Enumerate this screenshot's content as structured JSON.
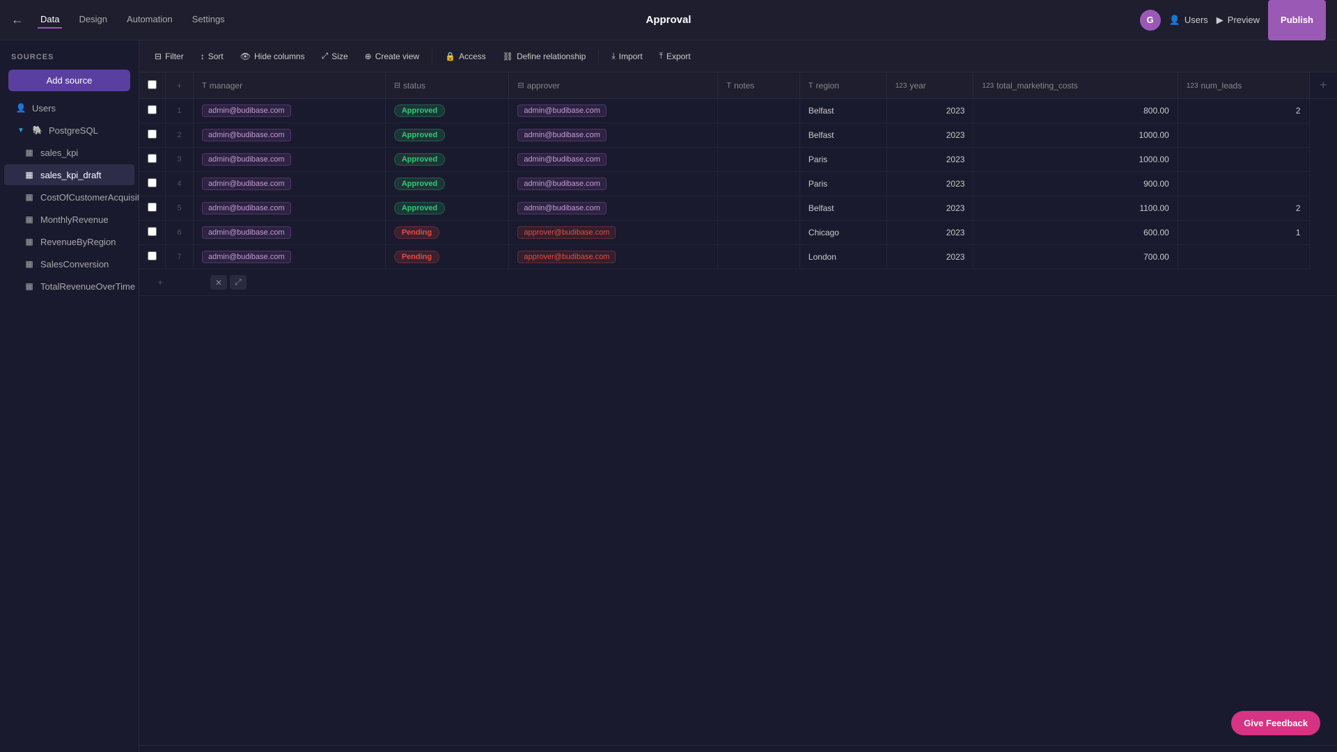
{
  "topnav": {
    "app_title": "Approval",
    "tabs": [
      {
        "label": "Data",
        "active": true
      },
      {
        "label": "Design",
        "active": false
      },
      {
        "label": "Automation",
        "active": false
      },
      {
        "label": "Settings",
        "active": false
      }
    ],
    "avatar_letter": "G",
    "users_label": "Users",
    "preview_label": "Preview",
    "publish_label": "Publish"
  },
  "sidebar": {
    "header": "Sources",
    "add_source_label": "Add source",
    "items": [
      {
        "label": "Users",
        "type": "users",
        "indent": 0
      },
      {
        "label": "PostgreSQL",
        "type": "postgres",
        "indent": 0,
        "expanded": true
      },
      {
        "label": "sales_kpi",
        "type": "table",
        "indent": 1
      },
      {
        "label": "sales_kpi_draft",
        "type": "table",
        "indent": 1,
        "active": true
      },
      {
        "label": "CostOfCustomerAcquisition",
        "type": "table",
        "indent": 1
      },
      {
        "label": "MonthlyRevenue",
        "type": "table",
        "indent": 1
      },
      {
        "label": "RevenueByRegion",
        "type": "table",
        "indent": 1
      },
      {
        "label": "SalesConversion",
        "type": "table",
        "indent": 1
      },
      {
        "label": "TotalRevenueOverTime",
        "type": "table",
        "indent": 1
      }
    ]
  },
  "toolbar": {
    "filter_label": "Filter",
    "sort_label": "Sort",
    "hide_columns_label": "Hide columns",
    "size_label": "Size",
    "create_view_label": "Create view",
    "access_label": "Access",
    "define_relationship_label": "Define relationship",
    "import_label": "Import",
    "export_label": "Export"
  },
  "table": {
    "columns": [
      {
        "name": "manager",
        "type": "text"
      },
      {
        "name": "status",
        "type": "text"
      },
      {
        "name": "approver",
        "type": "text"
      },
      {
        "name": "notes",
        "type": "text"
      },
      {
        "name": "region",
        "type": "text"
      },
      {
        "name": "year",
        "type": "number"
      },
      {
        "name": "total_marketing_costs",
        "type": "number"
      },
      {
        "name": "num_leads",
        "type": "number"
      }
    ],
    "rows": [
      {
        "id": 1,
        "manager": "admin@budibase.com",
        "status": "Approved",
        "approver": "admin@budibase.com",
        "notes": "",
        "region": "Belfast",
        "year": 2023,
        "total_marketing_costs": "800.00",
        "num_leads": "2"
      },
      {
        "id": 2,
        "manager": "admin@budibase.com",
        "status": "Approved",
        "approver": "admin@budibase.com",
        "notes": "",
        "region": "Belfast",
        "year": 2023,
        "total_marketing_costs": "1000.00",
        "num_leads": ""
      },
      {
        "id": 3,
        "manager": "admin@budibase.com",
        "status": "Approved",
        "approver": "admin@budibase.com",
        "notes": "",
        "region": "Paris",
        "year": 2023,
        "total_marketing_costs": "1000.00",
        "num_leads": ""
      },
      {
        "id": 4,
        "manager": "admin@budibase.com",
        "status": "Approved",
        "approver": "admin@budibase.com",
        "notes": "",
        "region": "Paris",
        "year": 2023,
        "total_marketing_costs": "900.00",
        "num_leads": ""
      },
      {
        "id": 5,
        "manager": "admin@budibase.com",
        "status": "Approved",
        "approver": "admin@budibase.com",
        "notes": "",
        "region": "Belfast",
        "year": 2023,
        "total_marketing_costs": "1100.00",
        "num_leads": "2"
      },
      {
        "id": 6,
        "manager": "admin@budibase.com",
        "status": "Pending",
        "approver": "approver@budibase.com",
        "notes": "",
        "region": "Chicago",
        "year": 2023,
        "total_marketing_costs": "600.00",
        "num_leads": "1"
      },
      {
        "id": 7,
        "manager": "admin@budibase.com",
        "status": "Pending",
        "approver": "approver@budibase.com",
        "notes": "",
        "region": "London",
        "year": 2023,
        "total_marketing_costs": "700.00",
        "num_leads": ""
      }
    ]
  },
  "feedback": {
    "label": "Give Feedback"
  }
}
